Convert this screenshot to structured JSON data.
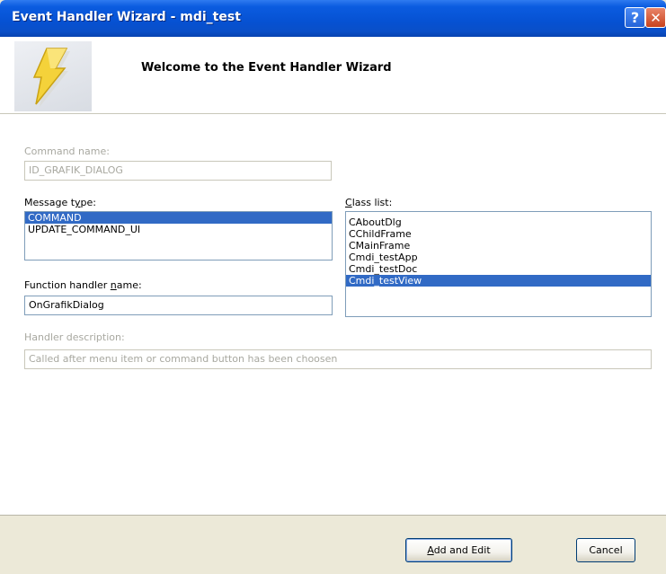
{
  "window": {
    "title": "Event Handler Wizard - mdi_test",
    "help_glyph": "?",
    "close_glyph": "✕"
  },
  "header": {
    "welcome": "Welcome to the Event Handler Wizard",
    "logo_icon": "lightning-bolt-icon"
  },
  "form": {
    "command_name_label": "Command name:",
    "command_name_value": "ID_GRAFIK_DIALOG",
    "message_type_label": "Message type:",
    "message_types": [
      "COMMAND",
      "UPDATE_COMMAND_UI"
    ],
    "message_type_selected": "COMMAND",
    "class_list_label": "Class list:",
    "classes": [
      "CAboutDlg",
      "CChildFrame",
      "CMainFrame",
      "Cmdi_testApp",
      "Cmdi_testDoc",
      "Cmdi_testView"
    ],
    "class_selected": "Cmdi_testView",
    "function_handler_label": "Function handler name:",
    "function_handler_value": "OnGrafikDialog",
    "handler_description_label": "Handler description:",
    "handler_description_value": "Called after menu item or command button has been choosen"
  },
  "buttons": {
    "add_edit": "Add and Edit",
    "cancel": "Cancel"
  },
  "colors": {
    "titlebar": "#0651d2",
    "selection": "#316ac5",
    "dialog_bg": "#ece9d8"
  }
}
